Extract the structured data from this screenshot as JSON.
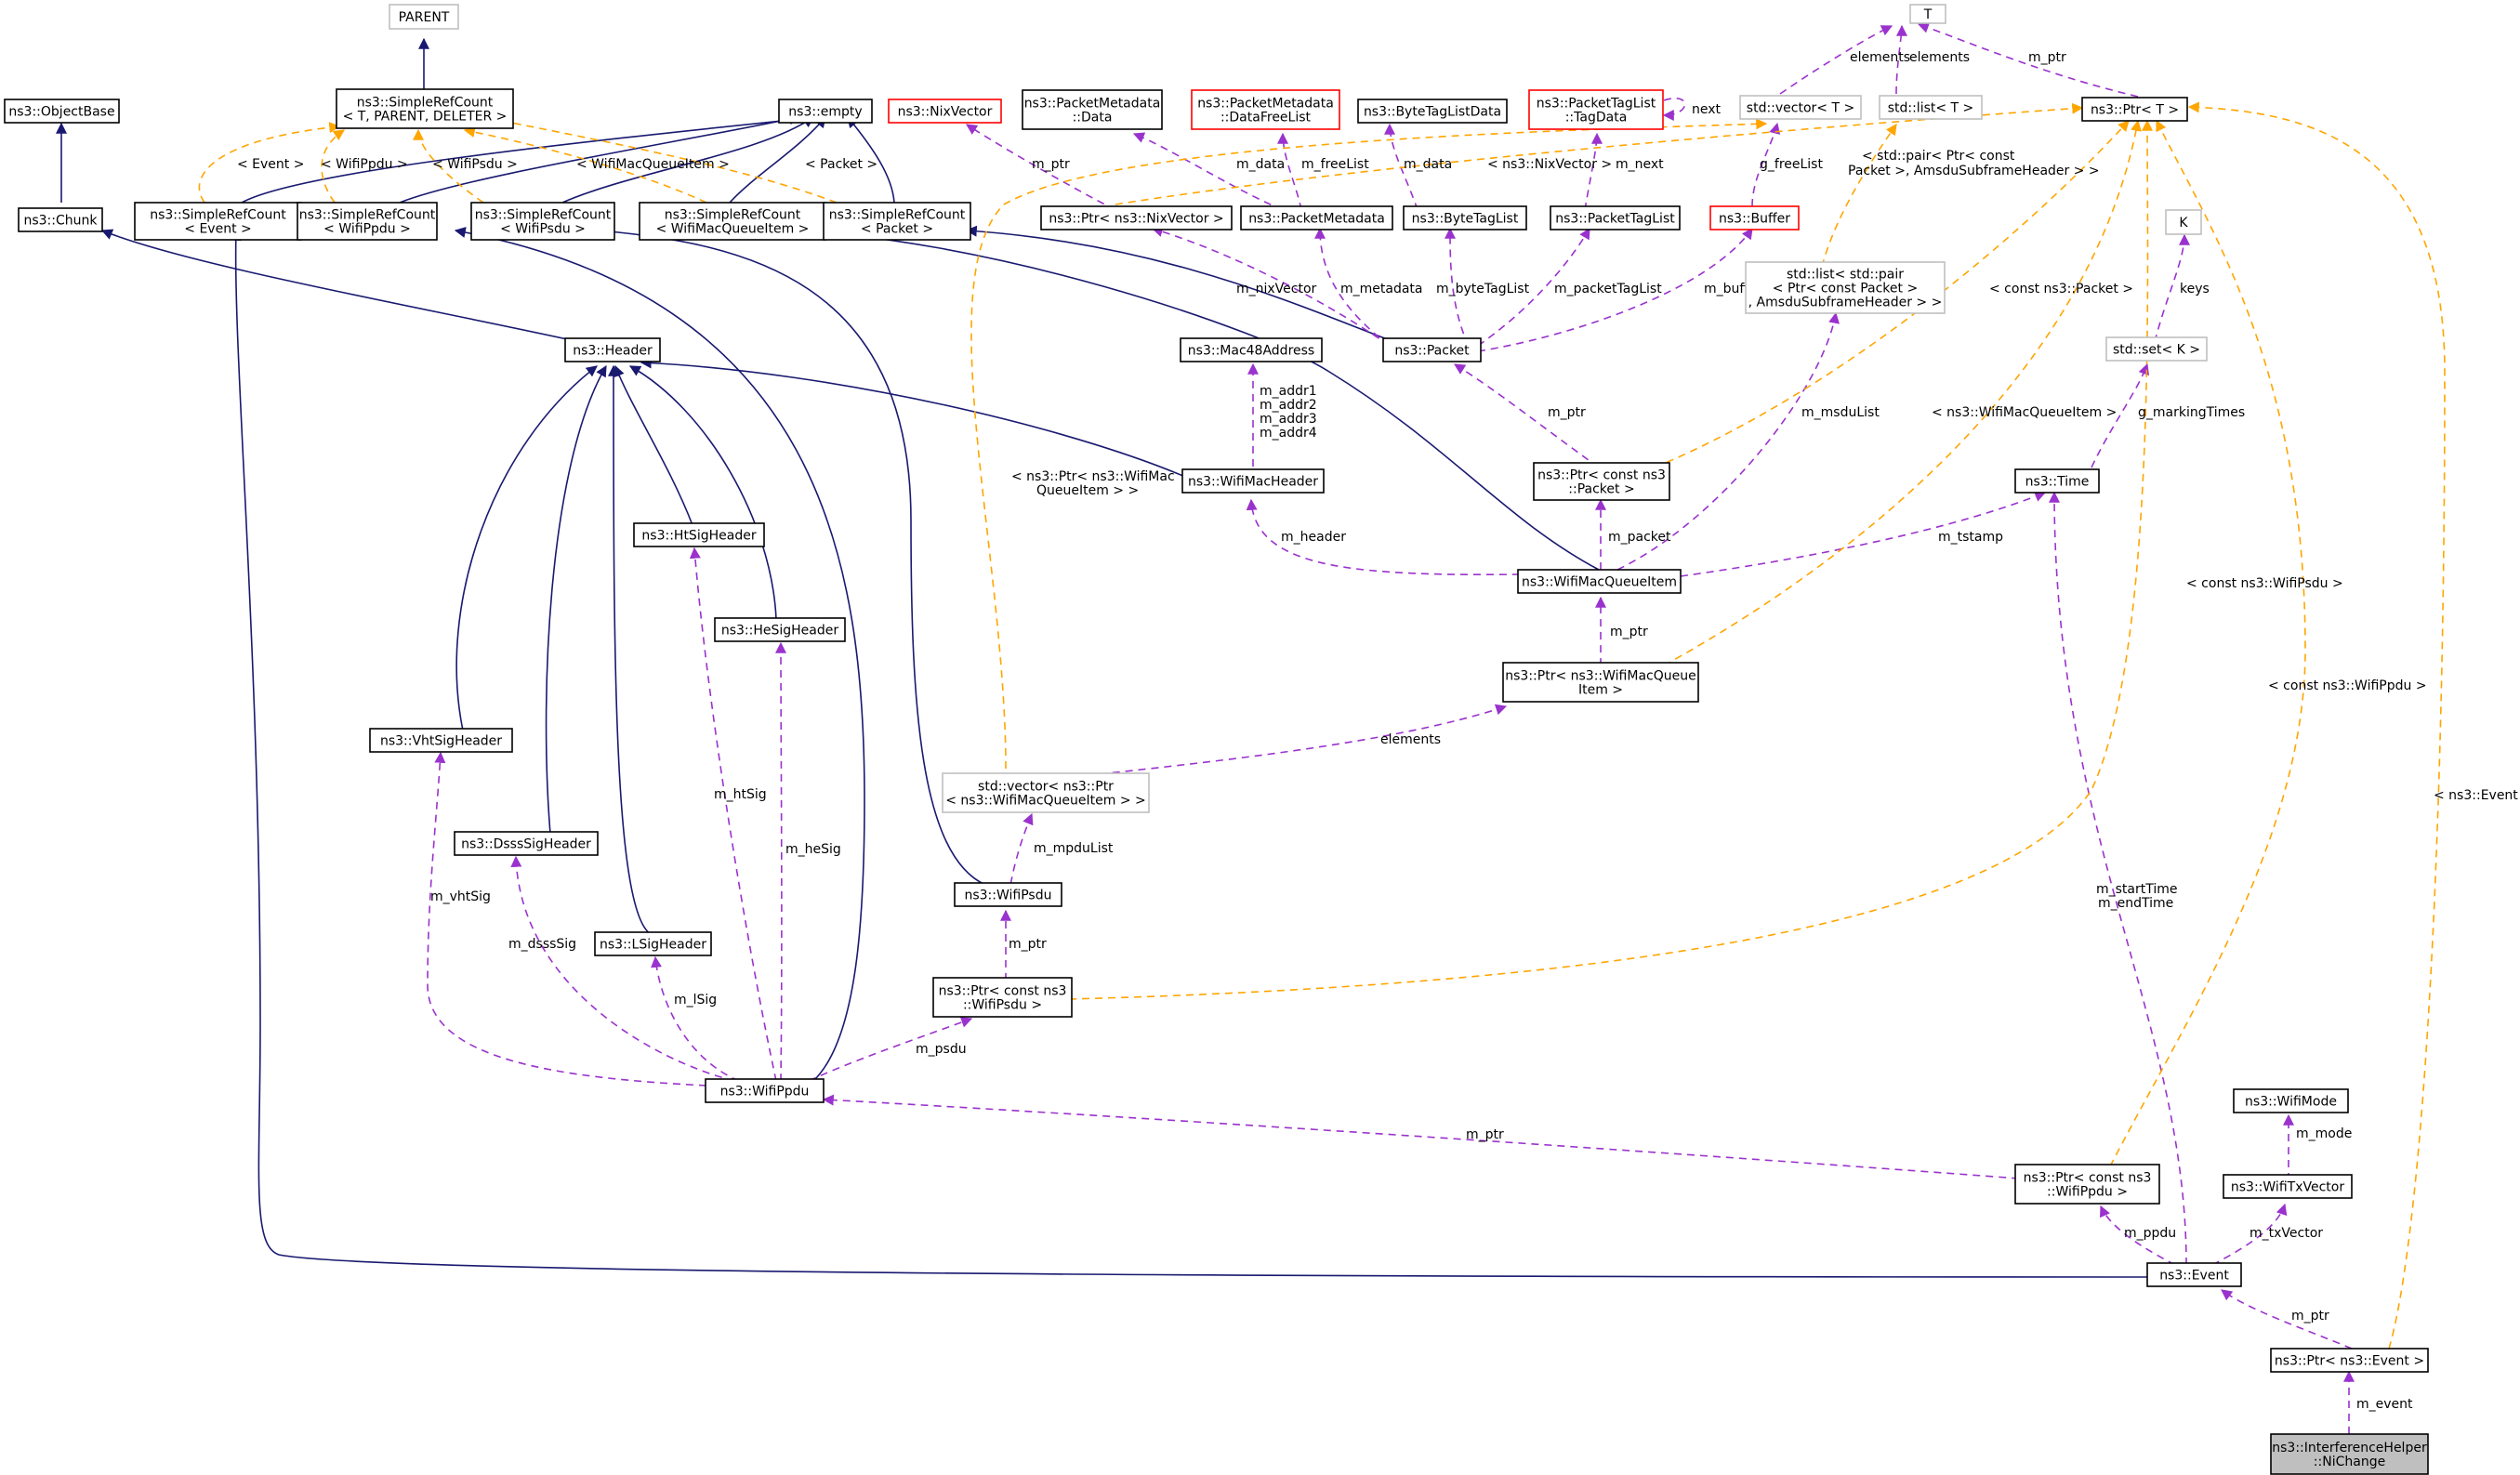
{
  "colors": {
    "node_border_normal": "#000000",
    "node_border_undocumented": "#bfbfbf",
    "node_border_truncated": "#ff0000",
    "node_fill_focus": "#bfbfbf",
    "edge_inheritance": "#191970",
    "edge_usage": "#9a32cd",
    "edge_template": "#ffa500"
  },
  "nodes": [
    {
      "id": "T",
      "lines": [
        "T"
      ],
      "style": "gray"
    },
    {
      "id": "PARENT",
      "lines": [
        "PARENT"
      ],
      "style": "gray"
    },
    {
      "id": "ObjectBase",
      "lines": [
        "ns3::ObjectBase"
      ],
      "style": "normal"
    },
    {
      "id": "SRC_TPD",
      "lines": [
        "ns3::SimpleRefCount",
        "< T, PARENT, DELETER >"
      ],
      "style": "normal"
    },
    {
      "id": "empty",
      "lines": [
        "ns3::empty"
      ],
      "style": "normal"
    },
    {
      "id": "NixVector",
      "lines": [
        "ns3::NixVector"
      ],
      "style": "red"
    },
    {
      "id": "PMData",
      "lines": [
        "ns3::PacketMetadata",
        "::Data"
      ],
      "style": "normal"
    },
    {
      "id": "PMDFL",
      "lines": [
        "ns3::PacketMetadata",
        "::DataFreeList"
      ],
      "style": "red"
    },
    {
      "id": "BTLData",
      "lines": [
        "ns3::ByteTagListData"
      ],
      "style": "normal"
    },
    {
      "id": "PTLTagData",
      "lines": [
        "ns3::PacketTagList",
        "::TagData"
      ],
      "style": "red"
    },
    {
      "id": "stdvectorT",
      "lines": [
        "std::vector< T >"
      ],
      "style": "gray"
    },
    {
      "id": "stdlistT",
      "lines": [
        "std::list< T >"
      ],
      "style": "gray"
    },
    {
      "id": "PtrT",
      "lines": [
        "ns3::Ptr< T >"
      ],
      "style": "normal"
    },
    {
      "id": "Chunk",
      "lines": [
        "ns3::Chunk"
      ],
      "style": "normal"
    },
    {
      "id": "SRC_Event",
      "lines": [
        "ns3::SimpleRefCount",
        "< Event >"
      ],
      "style": "normal"
    },
    {
      "id": "SRC_WifiPpdu",
      "lines": [
        "ns3::SimpleRefCount",
        "< WifiPpdu >"
      ],
      "style": "normal"
    },
    {
      "id": "SRC_WifiPsdu",
      "lines": [
        "ns3::SimpleRefCount",
        "< WifiPsdu >"
      ],
      "style": "normal"
    },
    {
      "id": "SRC_WMQI",
      "lines": [
        "ns3::SimpleRefCount",
        "< WifiMacQueueItem >"
      ],
      "style": "normal"
    },
    {
      "id": "SRC_Packet",
      "lines": [
        "ns3::SimpleRefCount",
        "< Packet >"
      ],
      "style": "normal"
    },
    {
      "id": "PtrNixVector",
      "lines": [
        "ns3::Ptr< ns3::NixVector >"
      ],
      "style": "normal"
    },
    {
      "id": "PacketMetadata",
      "lines": [
        "ns3::PacketMetadata"
      ],
      "style": "normal"
    },
    {
      "id": "ByteTagList",
      "lines": [
        "ns3::ByteTagList"
      ],
      "style": "normal"
    },
    {
      "id": "PacketTagList",
      "lines": [
        "ns3::PacketTagList"
      ],
      "style": "normal"
    },
    {
      "id": "Buffer",
      "lines": [
        "ns3::Buffer"
      ],
      "style": "red"
    },
    {
      "id": "K",
      "lines": [
        "K"
      ],
      "style": "gray"
    },
    {
      "id": "stdlistpair",
      "lines": [
        "std::list< std::pair",
        "< Ptr< const Packet >",
        ", AmsduSubframeHeader > >"
      ],
      "style": "gray"
    },
    {
      "id": "Header",
      "lines": [
        "ns3::Header"
      ],
      "style": "normal"
    },
    {
      "id": "Mac48Address",
      "lines": [
        "ns3::Mac48Address"
      ],
      "style": "normal"
    },
    {
      "id": "Packet",
      "lines": [
        "ns3::Packet"
      ],
      "style": "normal"
    },
    {
      "id": "stdsetK",
      "lines": [
        "std::set< K >"
      ],
      "style": "gray"
    },
    {
      "id": "Time",
      "lines": [
        "ns3::Time"
      ],
      "style": "normal"
    },
    {
      "id": "WifiMacHeader",
      "lines": [
        "ns3::WifiMacHeader"
      ],
      "style": "normal"
    },
    {
      "id": "PtrConstPacket",
      "lines": [
        "ns3::Ptr< const ns3",
        "::Packet >"
      ],
      "style": "normal"
    },
    {
      "id": "HtSigHeader",
      "lines": [
        "ns3::HtSigHeader"
      ],
      "style": "normal"
    },
    {
      "id": "WifiMacQueueItem",
      "lines": [
        "ns3::WifiMacQueueItem"
      ],
      "style": "normal"
    },
    {
      "id": "HeSigHeader",
      "lines": [
        "ns3::HeSigHeader"
      ],
      "style": "normal"
    },
    {
      "id": "PtrWMQI",
      "lines": [
        "ns3::Ptr< ns3::WifiMacQueue",
        "Item >"
      ],
      "style": "normal"
    },
    {
      "id": "VhtSigHeader",
      "lines": [
        "ns3::VhtSigHeader"
      ],
      "style": "normal"
    },
    {
      "id": "stdvectorPtr",
      "lines": [
        "std::vector< ns3::Ptr",
        "< ns3::WifiMacQueueItem > >"
      ],
      "style": "gray"
    },
    {
      "id": "DsssSigHeader",
      "lines": [
        "ns3::DsssSigHeader"
      ],
      "style": "normal"
    },
    {
      "id": "WifiPsdu",
      "lines": [
        "ns3::WifiPsdu"
      ],
      "style": "normal"
    },
    {
      "id": "LSigHeader",
      "lines": [
        "ns3::LSigHeader"
      ],
      "style": "normal"
    },
    {
      "id": "PtrConstWifiPsdu",
      "lines": [
        "ns3::Ptr< const ns3",
        "::WifiPsdu >"
      ],
      "style": "normal"
    },
    {
      "id": "WifiPpdu",
      "lines": [
        "ns3::WifiPpdu"
      ],
      "style": "normal"
    },
    {
      "id": "WifiMode",
      "lines": [
        "ns3::WifiMode"
      ],
      "style": "normal"
    },
    {
      "id": "PtrConstWifiPpdu",
      "lines": [
        "ns3::Ptr< const ns3",
        "::WifiPpdu >"
      ],
      "style": "normal"
    },
    {
      "id": "WifiTxVector",
      "lines": [
        "ns3::WifiTxVector"
      ],
      "style": "normal"
    },
    {
      "id": "Event",
      "lines": [
        "ns3::Event"
      ],
      "style": "normal"
    },
    {
      "id": "PtrEvent",
      "lines": [
        "ns3::Ptr< ns3::Event >"
      ],
      "style": "normal"
    },
    {
      "id": "NiChange",
      "lines": [
        "ns3::InterferenceHelper",
        "::NiChange"
      ],
      "style": "focus"
    }
  ],
  "edge_labels": [
    {
      "id": "lbl_elements1",
      "text": "elements"
    },
    {
      "id": "lbl_elements2",
      "text": "elements"
    },
    {
      "id": "lbl_mptr_T",
      "text": "m_ptr"
    },
    {
      "id": "lbl_next",
      "text": "next"
    },
    {
      "id": "lbl_event_tmpl",
      "text": "< Event >"
    },
    {
      "id": "lbl_wifippdu_tmpl",
      "text": "< WifiPpdu >"
    },
    {
      "id": "lbl_wifipsdu_tmpl",
      "text": "< WifiPsdu >"
    },
    {
      "id": "lbl_wmqi_tmpl",
      "text": "< WifiMacQueueItem >"
    },
    {
      "id": "lbl_packet_tmpl",
      "text": "< Packet >"
    },
    {
      "id": "lbl_nixvector_tmpl",
      "text": "< ns3::NixVector >"
    },
    {
      "id": "lbl_mptr_nix",
      "text": "m_ptr"
    },
    {
      "id": "lbl_mdata_pm",
      "text": "m_data"
    },
    {
      "id": "lbl_mfreelist",
      "text": "m_freeList"
    },
    {
      "id": "lbl_mdata_btl",
      "text": "m_data"
    },
    {
      "id": "lbl_mnext",
      "text": "m_next"
    },
    {
      "id": "lbl_gfreelist",
      "text": "g_freeList"
    },
    {
      "id": "lbl_stdpair_1",
      "text": "< std::pair< Ptr< const"
    },
    {
      "id": "lbl_stdpair_2",
      "text": "Packet >, AmsduSubframeHeader > >"
    },
    {
      "id": "lbl_mnixvector",
      "text": "m_nixVector"
    },
    {
      "id": "lbl_mmetadata",
      "text": "m_metadata"
    },
    {
      "id": "lbl_mbytetaglist",
      "text": "m_byteTagList"
    },
    {
      "id": "lbl_mpackettaglist",
      "text": "m_packetTagList"
    },
    {
      "id": "lbl_mbuffer",
      "text": "m_buffer"
    },
    {
      "id": "lbl_constpacket",
      "text": "< const ns3::Packet >"
    },
    {
      "id": "lbl_keys",
      "text": "keys"
    },
    {
      "id": "lbl_maddr1",
      "text": "m_addr1"
    },
    {
      "id": "lbl_maddr2",
      "text": "m_addr2"
    },
    {
      "id": "lbl_maddr3",
      "text": "m_addr3"
    },
    {
      "id": "lbl_maddr4",
      "text": "m_addr4"
    },
    {
      "id": "lbl_mptr_packet",
      "text": "m_ptr"
    },
    {
      "id": "lbl_mmsdulist",
      "text": "m_msduList"
    },
    {
      "id": "lbl_wmqi_tmpl2",
      "text": "< ns3::WifiMacQueueItem >"
    },
    {
      "id": "lbl_gmarkingtimes",
      "text": "g_markingTimes"
    },
    {
      "id": "lbl_ptrwmqi_tmpl_1",
      "text": "< ns3::Ptr< ns3::WifiMac"
    },
    {
      "id": "lbl_ptrwmqi_tmpl_2",
      "text": "QueueItem > >"
    },
    {
      "id": "lbl_mheader",
      "text": "m_header"
    },
    {
      "id": "lbl_mpacket",
      "text": "m_packet"
    },
    {
      "id": "lbl_mtstamp",
      "text": "m_tstamp"
    },
    {
      "id": "lbl_constwifipsdu",
      "text": "< const ns3::WifiPsdu >"
    },
    {
      "id": "lbl_mptr_wmqi",
      "text": "m_ptr"
    },
    {
      "id": "lbl_constwifippdu",
      "text": "< const ns3::WifiPpdu >"
    },
    {
      "id": "lbl_event_tmpl2",
      "text": "< ns3::Event >"
    },
    {
      "id": "lbl_melements",
      "text": "elements"
    },
    {
      "id": "lbl_mhtsig",
      "text": "m_htSig"
    },
    {
      "id": "lbl_mhesig",
      "text": "m_heSig"
    },
    {
      "id": "lbl_mvhtsig",
      "text": "m_vhtSig"
    },
    {
      "id": "lbl_mmpdulist",
      "text": "m_mpduList"
    },
    {
      "id": "lbl_mdssssig",
      "text": "m_dsssSig"
    },
    {
      "id": "lbl_mstarttime",
      "text": "m_startTime"
    },
    {
      "id": "lbl_mendtime",
      "text": "m_endTime"
    },
    {
      "id": "lbl_mptr_psdu",
      "text": "m_ptr"
    },
    {
      "id": "lbl_mlsig",
      "text": "m_lSig"
    },
    {
      "id": "lbl_mpsdu",
      "text": "m_psdu"
    },
    {
      "id": "lbl_mmode",
      "text": "m_mode"
    },
    {
      "id": "lbl_mptr_ppdu",
      "text": "m_ptr"
    },
    {
      "id": "lbl_mppdu",
      "text": "m_ppdu"
    },
    {
      "id": "lbl_mtxvector",
      "text": "m_txVector"
    },
    {
      "id": "lbl_mptr_event",
      "text": "m_ptr"
    },
    {
      "id": "lbl_mevent",
      "text": "m_event"
    }
  ]
}
